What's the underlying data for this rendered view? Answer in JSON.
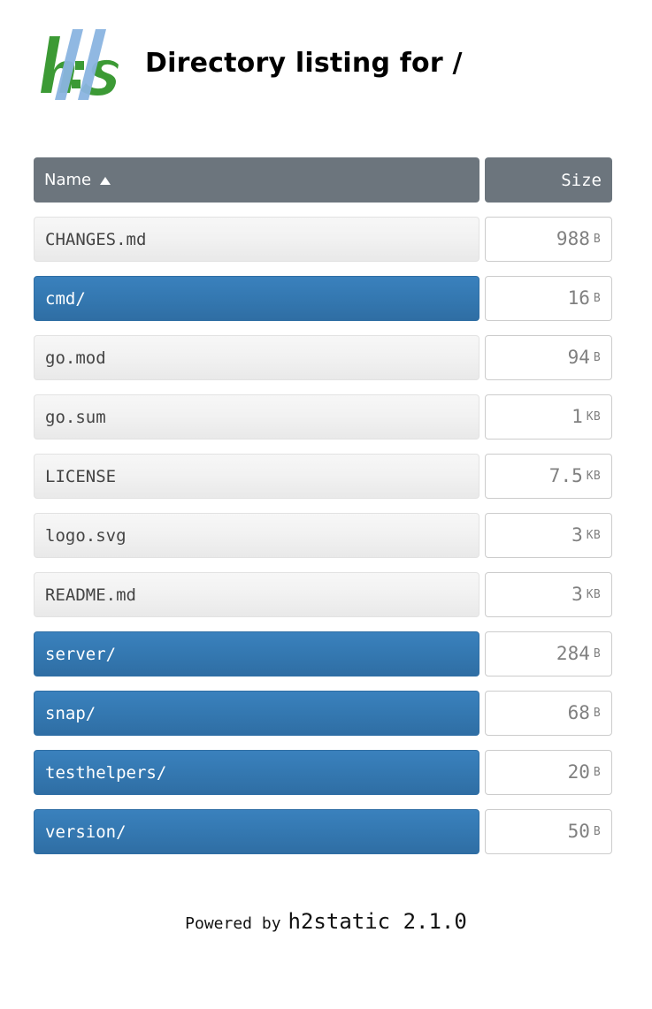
{
  "header": {
    "logo_icon": "h2static-logo-icon",
    "logo_colors": {
      "green": "#3c9a35",
      "blue": "#8ab4e0"
    },
    "title": "Directory listing for /"
  },
  "table": {
    "columns": {
      "name_label": "Name",
      "name_sort_icon": "sort-ascending-icon",
      "size_label": "Size"
    },
    "rows": [
      {
        "name": "CHANGES.md",
        "type": "file",
        "size_value": "988",
        "size_unit": "B"
      },
      {
        "name": "cmd/",
        "type": "dir",
        "size_value": "16",
        "size_unit": "B"
      },
      {
        "name": "go.mod",
        "type": "file",
        "size_value": "94",
        "size_unit": "B"
      },
      {
        "name": "go.sum",
        "type": "file",
        "size_value": "1",
        "size_unit": "KB"
      },
      {
        "name": "LICENSE",
        "type": "file",
        "size_value": "7.5",
        "size_unit": "KB"
      },
      {
        "name": "logo.svg",
        "type": "file",
        "size_value": "3",
        "size_unit": "KB"
      },
      {
        "name": "README.md",
        "type": "file",
        "size_value": "3",
        "size_unit": "KB"
      },
      {
        "name": "server/",
        "type": "dir",
        "size_value": "284",
        "size_unit": "B"
      },
      {
        "name": "snap/",
        "type": "dir",
        "size_value": "68",
        "size_unit": "B"
      },
      {
        "name": "testhelpers/",
        "type": "dir",
        "size_value": "20",
        "size_unit": "B"
      },
      {
        "name": "version/",
        "type": "dir",
        "size_value": "50",
        "size_unit": "B"
      }
    ]
  },
  "footer": {
    "prefix": "Powered by",
    "app": "h2static 2.1.0"
  },
  "colors": {
    "header_bg": "#6c757d",
    "dir_bg": "#3478b1",
    "file_bg": "#f0f0f0",
    "size_text": "#808080"
  }
}
